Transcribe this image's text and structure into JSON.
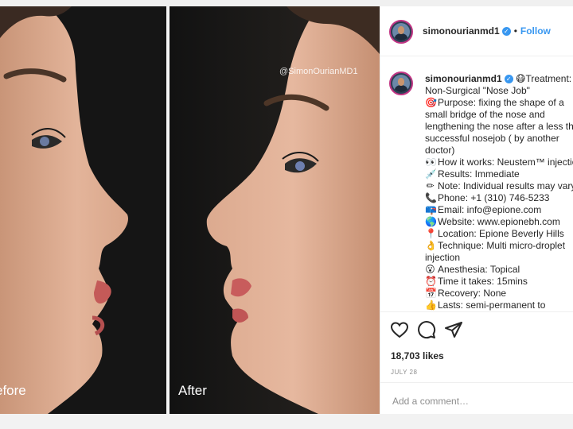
{
  "post": {
    "image": {
      "watermark": "@SimonOurianMD1",
      "before_label": "efore",
      "after_label": "After"
    }
  },
  "header": {
    "username": "simonourianmd1",
    "verified": true,
    "separator": "•",
    "follow_label": "Follow"
  },
  "caption": {
    "username": "simonourianmd1",
    "lines": [
      {
        "icon": "",
        "text": "😷Treatment:"
      },
      {
        "icon": "",
        "text": "Non-Surgical \"Nose Job\""
      },
      {
        "icon": "🎯",
        "text": "Purpose: fixing the shape of a"
      },
      {
        "icon": "",
        "text": "small bridge of the nose and"
      },
      {
        "icon": "",
        "text": "lengthening the nose after a less than"
      },
      {
        "icon": "",
        "text": "successful nosejob ( by another"
      },
      {
        "icon": "",
        "text": "doctor)"
      },
      {
        "icon": "👀",
        "text": "How it works: Neustem™ injection"
      },
      {
        "icon": "💉",
        "text": "Results: Immediate"
      },
      {
        "icon": "✏",
        "text": "Note: Individual results may vary"
      },
      {
        "icon": "📞",
        "text": "Phone: +1 (310) 746-5233"
      },
      {
        "icon": "📪",
        "text": "Email: info@epione.com"
      },
      {
        "icon": "🌎",
        "text": "Website: www.epionebh.com"
      },
      {
        "icon": "📍",
        "text": "Location: Epione Beverly Hills"
      },
      {
        "icon": "👌",
        "text": "Technique: Multi micro-droplet"
      },
      {
        "icon": "",
        "text": "injection"
      },
      {
        "icon": "😮",
        "text": "Anesthesia: Topical"
      },
      {
        "icon": "⏰",
        "text": "Time it takes: 15mins"
      },
      {
        "icon": "📅",
        "text": "Recovery: None"
      },
      {
        "icon": "👍",
        "text": "Lasts: semi-permanent to"
      }
    ]
  },
  "actions": {
    "like_icon": "heart-icon",
    "comment_icon": "comment-icon",
    "share_icon": "share-icon",
    "likes_text": "18,703 likes",
    "date_text": "JULY 28"
  },
  "comment": {
    "placeholder": "Add a comment…"
  },
  "colors": {
    "follow_blue": "#3897f0",
    "verified_blue": "#3897f0",
    "text": "#262626",
    "muted": "#8e8e8e"
  }
}
